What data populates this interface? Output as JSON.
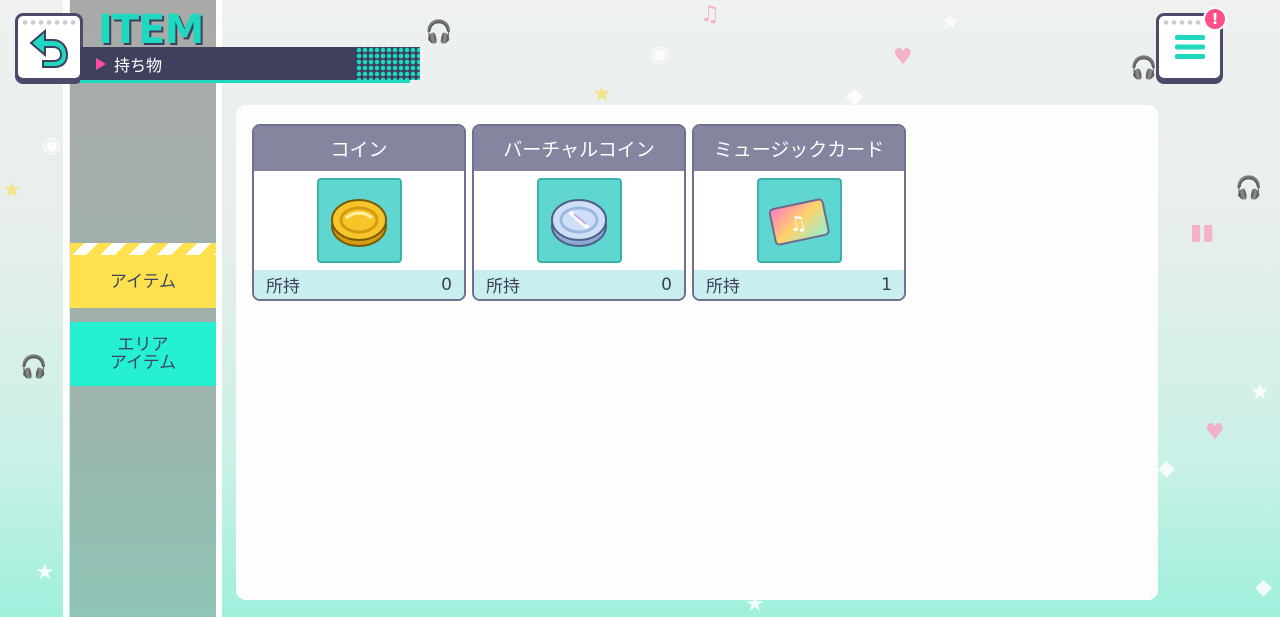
{
  "header": {
    "title": "ITEM",
    "subtitle": "持ち物"
  },
  "notification_badge": "!",
  "sidebar": {
    "tabs": [
      {
        "label": "アイテム",
        "selected": true
      },
      {
        "label": "エリア\nアイテム",
        "selected": false
      }
    ]
  },
  "items": [
    {
      "name": "コイン",
      "owned_label": "所持",
      "count": "0",
      "icon": "coin-icon"
    },
    {
      "name": "バーチャルコイン",
      "owned_label": "所持",
      "count": "0",
      "icon": "virtual-coin-icon"
    },
    {
      "name": "ミュージックカード",
      "owned_label": "所持",
      "count": "1",
      "icon": "music-card-icon"
    }
  ],
  "colors": {
    "accent": "#1fd8c0",
    "navy": "#3f405d",
    "tab_selected": "#ffe14e",
    "tab_area": "#26f0d4",
    "badge": "#ff4f8b"
  }
}
